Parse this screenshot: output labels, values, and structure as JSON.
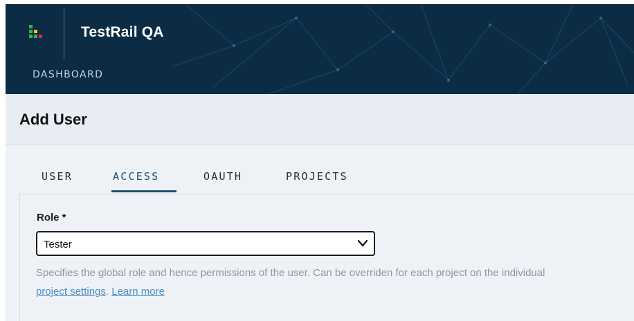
{
  "header": {
    "app_title": "TestRail QA",
    "nav_dashboard": "DASHBOARD"
  },
  "page": {
    "title": "Add User"
  },
  "tabs": [
    {
      "label": "USER",
      "active": false
    },
    {
      "label": "ACCESS",
      "active": true
    },
    {
      "label": "OAUTH",
      "active": false
    },
    {
      "label": "PROJECTS",
      "active": false
    }
  ],
  "access": {
    "role_label": "Role *",
    "role_value": "Tester",
    "help_text_before": "Specifies the global role and hence permissions of the user. Can be overriden for each project on the individual ",
    "help_link_project_settings": "project settings",
    "help_separator": ". ",
    "help_link_learn_more": "Learn more"
  },
  "colors": {
    "header_bg": "#0c2c45",
    "title_band_bg": "#e8edf3",
    "content_bg": "#eef2f6",
    "active_tab": "#1f4f70",
    "link": "#4a8fc9",
    "help_text": "#8c96a0",
    "logo_green": "#3fae49",
    "logo_yellow": "#f2c318",
    "logo_red": "#e0245e"
  },
  "icons": {
    "logo": "testrail-logo-icon",
    "select_chevron": "chevron-down-icon"
  }
}
